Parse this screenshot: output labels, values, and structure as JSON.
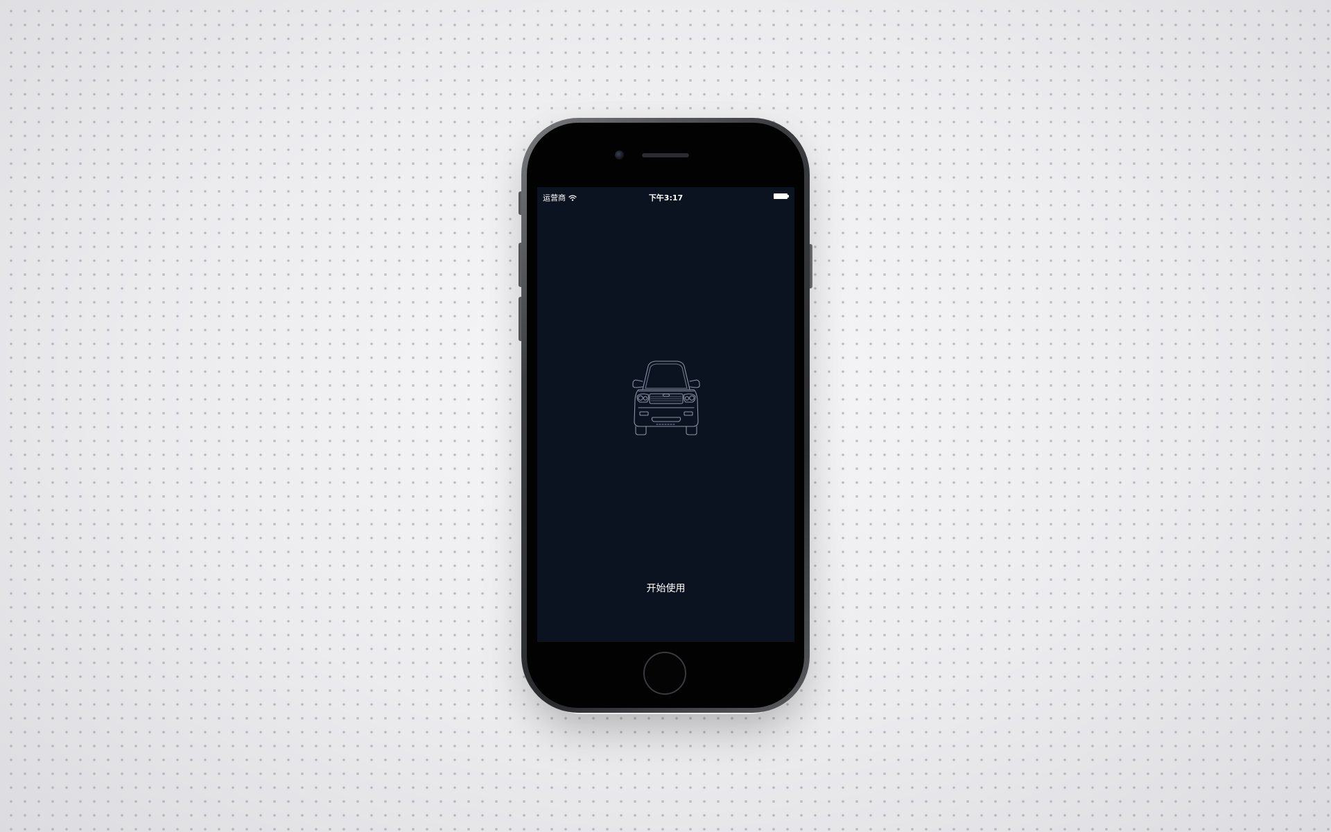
{
  "status_bar": {
    "carrier": "运营商",
    "wifi_icon": "wifi-icon",
    "time": "下午3:17",
    "battery_icon": "battery-icon"
  },
  "splash": {
    "illustration_icon": "car-front-outline-icon",
    "start_button_label": "开始使用"
  },
  "colors": {
    "screen_background": "#0c1320",
    "text": "#ffffff",
    "car_outline": "#8a93a8",
    "page_background": "#ececef"
  }
}
